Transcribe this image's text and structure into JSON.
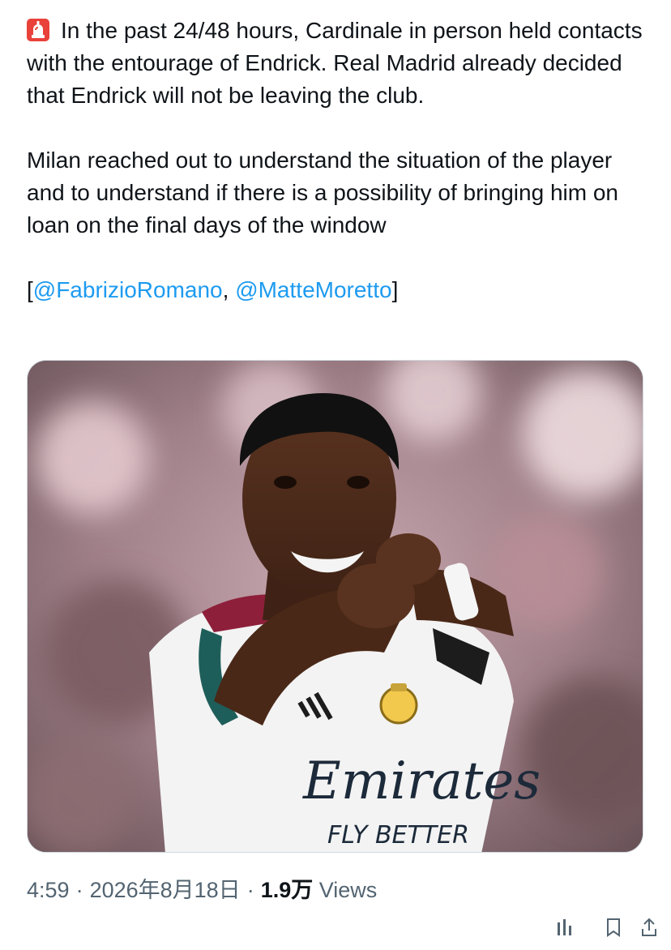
{
  "tweet": {
    "paragraphs": [
      "In the past 24/48 hours, Cardinale in person held contacts with the entourage of Endrick. Real Madrid already decided that Endrick will not be leaving the club.",
      "Milan reached out to understand the situation of the player and to understand if there is a possibility of bringing him on loan on the final days of the window"
    ],
    "credits_open": "[",
    "mention_1": "@FabrizioRomano",
    "credits_sep": ", ",
    "mention_2": "@MatteMoretto",
    "credits_close": "]",
    "leading_icon": "siren-emoji-icon"
  },
  "media": {
    "kit_sponsor_text": "Emirates",
    "kit_sponsor_sub": "FLY BETTER"
  },
  "meta": {
    "time": "4:59",
    "dot": "·",
    "date": "2026年8月18日",
    "views_count": "1.9万",
    "views_label": "Views"
  },
  "colors": {
    "link": "#1d9bf0",
    "text": "#0f1419",
    "muted": "#536471"
  }
}
